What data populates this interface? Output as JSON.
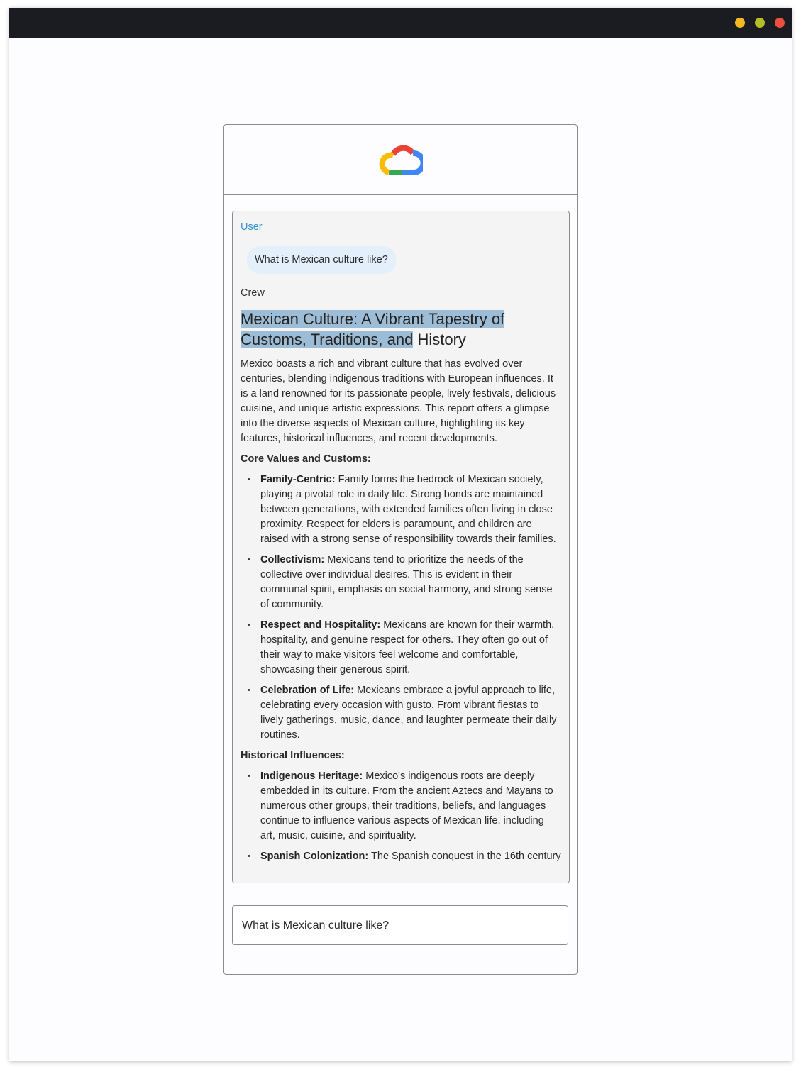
{
  "window": {
    "controls": [
      {
        "name": "minimize",
        "color": "#f4b822"
      },
      {
        "name": "maximize",
        "color": "#b4bf27"
      },
      {
        "name": "close",
        "color": "#ec4f3b"
      }
    ]
  },
  "header": {
    "logo": "google-cloud-logo"
  },
  "chat": {
    "messages": [
      {
        "role": "User",
        "text": "What is Mexican culture like?"
      },
      {
        "role": "Crew"
      }
    ],
    "report": {
      "title_highlighted": "Mexican Culture: A Vibrant Tapestry of Customs, Traditions, and",
      "title_rest": " History",
      "intro": "Mexico boasts a rich and vibrant culture that has evolved over centuries, blending indigenous traditions with European influences. It is a land renowned for its passionate people, lively festivals, delicious cuisine, and unique artistic expressions. This report offers a glimpse into the diverse aspects of Mexican culture, highlighting its key features, historical influences, and recent developments.",
      "sections": [
        {
          "heading": "Core Values and Customs:",
          "items": [
            {
              "term": "Family-Centric:",
              "text": " Family forms the bedrock of Mexican society, playing a pivotal role in daily life. Strong bonds are maintained between generations, with extended families often living in close proximity. Respect for elders is paramount, and children are raised with a strong sense of responsibility towards their families."
            },
            {
              "term": "Collectivism:",
              "text": " Mexicans tend to prioritize the needs of the collective over individual desires. This is evident in their communal spirit, emphasis on social harmony, and strong sense of community."
            },
            {
              "term": "Respect and Hospitality:",
              "text": " Mexicans are known for their warmth, hospitality, and genuine respect for others. They often go out of their way to make visitors feel welcome and comfortable, showcasing their generous spirit."
            },
            {
              "term": "Celebration of Life:",
              "text": " Mexicans embrace a joyful approach to life, celebrating every occasion with gusto. From vibrant fiestas to lively gatherings, music, dance, and laughter permeate their daily routines."
            }
          ]
        },
        {
          "heading": "Historical Influences:",
          "items": [
            {
              "term": "Indigenous Heritage:",
              "text": " Mexico's indigenous roots are deeply embedded in its culture. From the ancient Aztecs and Mayans to numerous other groups, their traditions, beliefs, and languages continue to influence various aspects of Mexican life, including art, music, cuisine, and spirituality."
            },
            {
              "term": "Spanish Colonization:",
              "text": " The Spanish conquest in the 16th century"
            }
          ]
        }
      ]
    }
  },
  "input": {
    "value": "What is Mexican culture like?"
  }
}
